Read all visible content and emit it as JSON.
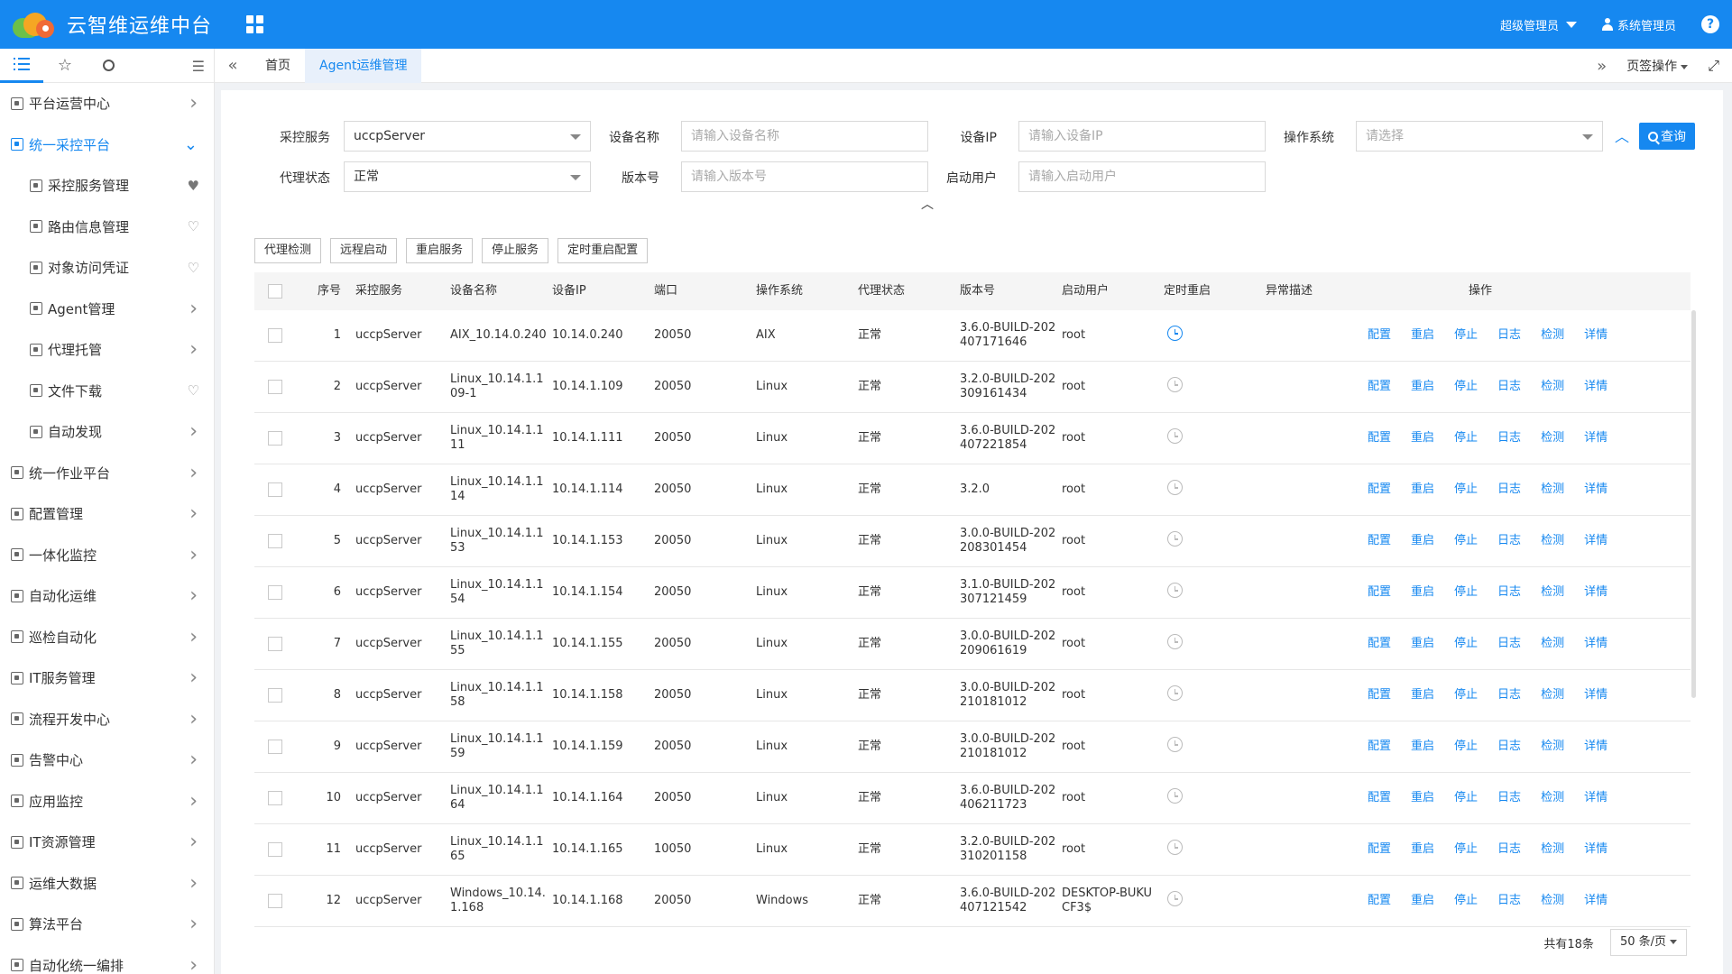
{
  "app": {
    "title": "云智维运维中台"
  },
  "header": {
    "role": "超级管理员",
    "user": "系统管理员",
    "help": "?"
  },
  "sidebar": {
    "items": [
      {
        "label": "平台运营中心",
        "level": 1,
        "trail": "arrow"
      },
      {
        "label": "统一采控平台",
        "level": 1,
        "trail": "arrow-down",
        "active": true
      },
      {
        "label": "采控服务管理",
        "level": 2,
        "trail": "heart-filled"
      },
      {
        "label": "路由信息管理",
        "level": 2,
        "trail": "heart"
      },
      {
        "label": "对象访问凭证",
        "level": 2,
        "trail": "heart"
      },
      {
        "label": "Agent管理",
        "level": 2,
        "trail": "arrow"
      },
      {
        "label": "代理托管",
        "level": 2,
        "trail": "arrow"
      },
      {
        "label": "文件下载",
        "level": 2,
        "trail": "heart"
      },
      {
        "label": "自动发现",
        "level": 2,
        "trail": "arrow"
      },
      {
        "label": "统一作业平台",
        "level": 1,
        "trail": "arrow"
      },
      {
        "label": "配置管理",
        "level": 1,
        "trail": "arrow"
      },
      {
        "label": "一体化监控",
        "level": 1,
        "trail": "arrow"
      },
      {
        "label": "自动化运维",
        "level": 1,
        "trail": "arrow"
      },
      {
        "label": "巡检自动化",
        "level": 1,
        "trail": "arrow"
      },
      {
        "label": "IT服务管理",
        "level": 1,
        "trail": "arrow"
      },
      {
        "label": "流程开发中心",
        "level": 1,
        "trail": "arrow"
      },
      {
        "label": "告警中心",
        "level": 1,
        "trail": "arrow"
      },
      {
        "label": "应用监控",
        "level": 1,
        "trail": "arrow"
      },
      {
        "label": "IT资源管理",
        "level": 1,
        "trail": "arrow"
      },
      {
        "label": "运维大数据",
        "level": 1,
        "trail": "arrow"
      },
      {
        "label": "算法平台",
        "level": 1,
        "trail": "arrow"
      },
      {
        "label": "自动化统一编排",
        "level": 1,
        "trail": "arrow"
      }
    ]
  },
  "tabs": {
    "home": "首页",
    "current": "Agent运维管理",
    "page_ops": "页签操作"
  },
  "filters": {
    "service_label": "采控服务",
    "service_value": "uccpServer",
    "device_label": "设备名称",
    "device_placeholder": "请输入设备名称",
    "ip_label": "设备IP",
    "ip_placeholder": "请输入设备IP",
    "os_label": "操作系统",
    "os_placeholder": "请选择",
    "status_label": "代理状态",
    "status_value": "正常",
    "version_label": "版本号",
    "version_placeholder": "请输入版本号",
    "user_label": "启动用户",
    "user_placeholder": "请输入启动用户",
    "query": "查询"
  },
  "actions": [
    "代理检测",
    "远程启动",
    "重启服务",
    "停止服务",
    "定时重启配置"
  ],
  "table": {
    "headers": [
      "序号",
      "采控服务",
      "设备名称",
      "设备IP",
      "端口",
      "操作系统",
      "代理状态",
      "版本号",
      "启动用户",
      "定时重启",
      "异常描述",
      "操作"
    ],
    "ops": [
      "配置",
      "重启",
      "停止",
      "日志",
      "检测",
      "详情"
    ],
    "rows": [
      {
        "idx": "1",
        "svc": "uccpServer",
        "dev": "AIX_10.14.0.240",
        "ip": "10.14.0.240",
        "port": "20050",
        "os": "AIX",
        "status": "正常",
        "ver": "3.6.0-BUILD-202407171646",
        "user": "root",
        "timer": true
      },
      {
        "idx": "2",
        "svc": "uccpServer",
        "dev": "Linux_10.14.1.109-1",
        "ip": "10.14.1.109",
        "port": "20050",
        "os": "Linux",
        "status": "正常",
        "ver": "3.2.0-BUILD-202309161434",
        "user": "root",
        "timer": false
      },
      {
        "idx": "3",
        "svc": "uccpServer",
        "dev": "Linux_10.14.1.111",
        "ip": "10.14.1.111",
        "port": "20050",
        "os": "Linux",
        "status": "正常",
        "ver": "3.6.0-BUILD-202407221854",
        "user": "root",
        "timer": false
      },
      {
        "idx": "4",
        "svc": "uccpServer",
        "dev": "Linux_10.14.1.114",
        "ip": "10.14.1.114",
        "port": "20050",
        "os": "Linux",
        "status": "正常",
        "ver": "3.2.0",
        "user": "root",
        "timer": false
      },
      {
        "idx": "5",
        "svc": "uccpServer",
        "dev": "Linux_10.14.1.153",
        "ip": "10.14.1.153",
        "port": "20050",
        "os": "Linux",
        "status": "正常",
        "ver": "3.0.0-BUILD-202208301454",
        "user": "root",
        "timer": false
      },
      {
        "idx": "6",
        "svc": "uccpServer",
        "dev": "Linux_10.14.1.154",
        "ip": "10.14.1.154",
        "port": "20050",
        "os": "Linux",
        "status": "正常",
        "ver": "3.1.0-BUILD-202307121459",
        "user": "root",
        "timer": false
      },
      {
        "idx": "7",
        "svc": "uccpServer",
        "dev": "Linux_10.14.1.155",
        "ip": "10.14.1.155",
        "port": "20050",
        "os": "Linux",
        "status": "正常",
        "ver": "3.0.0-BUILD-202209061619",
        "user": "root",
        "timer": false
      },
      {
        "idx": "8",
        "svc": "uccpServer",
        "dev": "Linux_10.14.1.158",
        "ip": "10.14.1.158",
        "port": "20050",
        "os": "Linux",
        "status": "正常",
        "ver": "3.0.0-BUILD-202210181012",
        "user": "root",
        "timer": false
      },
      {
        "idx": "9",
        "svc": "uccpServer",
        "dev": "Linux_10.14.1.159",
        "ip": "10.14.1.159",
        "port": "20050",
        "os": "Linux",
        "status": "正常",
        "ver": "3.0.0-BUILD-202210181012",
        "user": "root",
        "timer": false
      },
      {
        "idx": "10",
        "svc": "uccpServer",
        "dev": "Linux_10.14.1.164",
        "ip": "10.14.1.164",
        "port": "20050",
        "os": "Linux",
        "status": "正常",
        "ver": "3.6.0-BUILD-202406211723",
        "user": "root",
        "timer": false
      },
      {
        "idx": "11",
        "svc": "uccpServer",
        "dev": "Linux_10.14.1.165",
        "ip": "10.14.1.165",
        "port": "10050",
        "os": "Linux",
        "status": "正常",
        "ver": "3.2.0-BUILD-202310201158",
        "user": "root",
        "timer": false
      },
      {
        "idx": "12",
        "svc": "uccpServer",
        "dev": "Windows_10.14.1.168",
        "ip": "10.14.1.168",
        "port": "20050",
        "os": "Windows",
        "status": "正常",
        "ver": "3.6.0-BUILD-202407121542",
        "user": "DESKTOP-BUKUCF3$",
        "timer": false
      }
    ]
  },
  "pager": {
    "total": "共有18条",
    "page_size": "50 条/页"
  },
  "icons": {
    "logo": "cloud-logo-icon",
    "apps": "apps-grid-icon",
    "user": "user-icon",
    "help": "help-icon",
    "timer": "clock-icon"
  },
  "colors": {
    "primary": "#1688f0",
    "header": "#1688f0"
  }
}
